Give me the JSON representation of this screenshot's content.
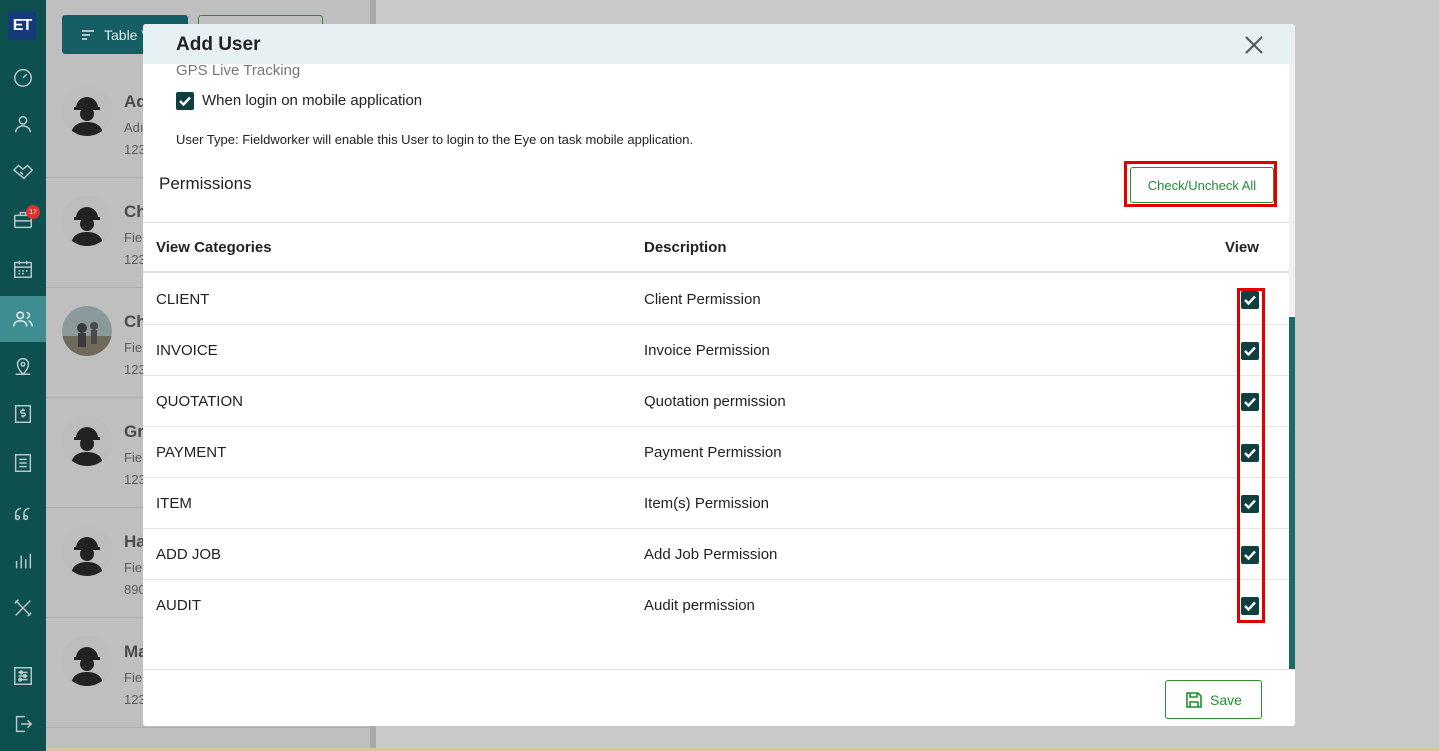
{
  "sidebar": {
    "logo": "ET",
    "badge_count": "17",
    "items": [
      {
        "name": "dashboard-icon",
        "active": false
      },
      {
        "name": "user-icon",
        "active": false
      },
      {
        "name": "handshake-icon",
        "active": false
      },
      {
        "name": "briefcase-icon",
        "active": false
      },
      {
        "name": "calendar-icon",
        "active": false
      },
      {
        "name": "users-icon",
        "active": true
      },
      {
        "name": "map-pin-icon",
        "active": false
      },
      {
        "name": "dollar-icon",
        "active": false
      },
      {
        "name": "list-icon",
        "active": false
      },
      {
        "name": "quote-icon",
        "active": false
      },
      {
        "name": "bar-chart-icon",
        "active": false
      },
      {
        "name": "tools-icon",
        "active": false
      },
      {
        "name": "settings-sliders-icon",
        "active": false
      },
      {
        "name": "logout-icon",
        "active": false
      }
    ]
  },
  "list_panel": {
    "table_button": "Table V",
    "rows": [
      {
        "name": "Ad",
        "sub": "Adı",
        "num": "123"
      },
      {
        "name": "Ch",
        "sub": "Fie",
        "num": "123"
      },
      {
        "name": "Ch",
        "sub": "Fie",
        "num": "123"
      },
      {
        "name": "Gr",
        "sub": "Fie",
        "num": "123"
      },
      {
        "name": "Ha",
        "sub": "Fie",
        "num": "890"
      },
      {
        "name": "Ma",
        "sub": "Fie",
        "num": "123"
      }
    ]
  },
  "modal": {
    "title": "Add User",
    "gps_label": "GPS Live Tracking",
    "login_checkbox_label": "When login on mobile application",
    "login_checked": true,
    "user_type_note": "User Type: Fieldworker will enable this User to login to the Eye on task mobile application.",
    "permissions_title": "Permissions",
    "check_all_label": "Check/Uncheck All",
    "columns": {
      "category": "View Categories",
      "description": "Description",
      "view": "View"
    },
    "rows": [
      {
        "category": "CLIENT",
        "description": "Client Permission",
        "view": true
      },
      {
        "category": "INVOICE",
        "description": "Invoice Permission",
        "view": true
      },
      {
        "category": "QUOTATION",
        "description": "Quotation permission",
        "view": true
      },
      {
        "category": "PAYMENT",
        "description": "Payment Permission",
        "view": true
      },
      {
        "category": "ITEM",
        "description": "Item(s) Permission",
        "view": true
      },
      {
        "category": "ADD JOB",
        "description": "Add Job Permission",
        "view": true
      },
      {
        "category": "AUDIT",
        "description": "Audit permission",
        "view": true
      }
    ],
    "save_label": "Save"
  },
  "colors": {
    "sidebar": "#0e4f4f",
    "checkbox": "#0f3f3f",
    "accent_green": "#1f8f2f",
    "highlight": "#e00000"
  }
}
